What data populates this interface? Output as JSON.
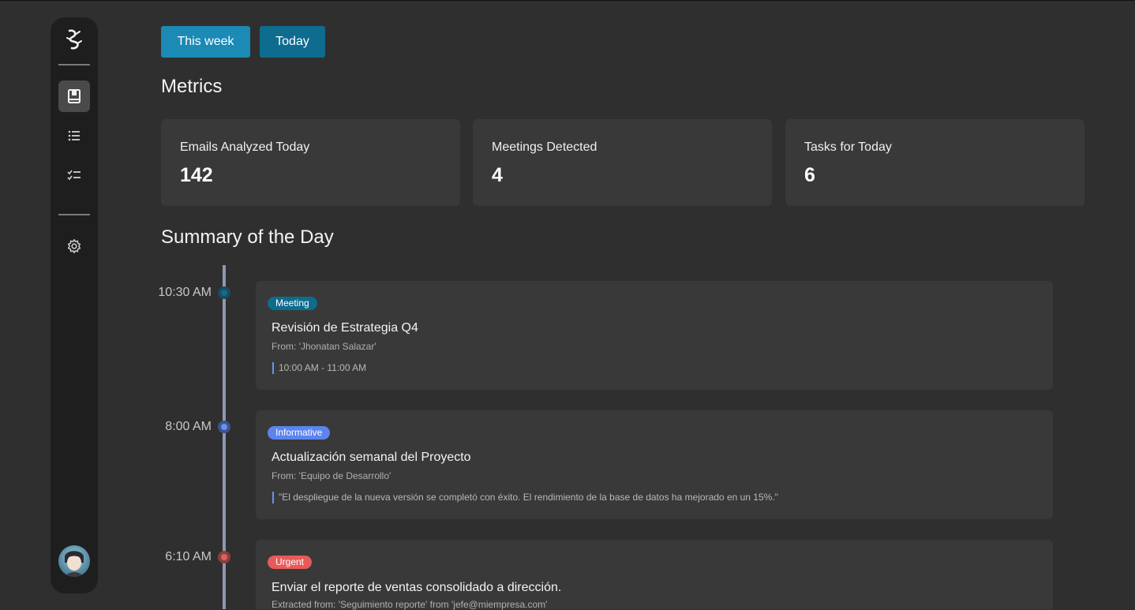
{
  "filters": {
    "week_label": "This week",
    "today_label": "Today"
  },
  "sections": {
    "metrics": "Metrics",
    "summary": "Summary of the Day"
  },
  "metrics": [
    {
      "label": "Emails Analyzed Today",
      "value": "142"
    },
    {
      "label": "Meetings Detected",
      "value": "4"
    },
    {
      "label": "Tasks for Today",
      "value": "6"
    }
  ],
  "sidebar": {
    "items": [
      {
        "icon": "book-icon",
        "active": true
      },
      {
        "icon": "list-icon",
        "active": false
      },
      {
        "icon": "checklist-icon",
        "active": false
      },
      {
        "icon": "gear-icon",
        "active": false
      }
    ]
  },
  "timeline": [
    {
      "time": "10:30 AM",
      "badge": "Meeting",
      "title": "Revisión de Estrategia Q4",
      "from": "From: 'Jhonatan Salazar'",
      "detail": "10:00 AM - 11:00 AM"
    },
    {
      "time": "8:00 AM",
      "badge": "Informative",
      "title": "Actualización semanal del Proyecto",
      "from": "From: 'Equipo de Desarrollo'",
      "detail": "\"El despliegue de la nueva versión se completó con éxito. El rendimiento de la base de datos ha mejorado en un 15%.\""
    },
    {
      "time": "6:10 AM",
      "badge": "Urgent",
      "title": "Enviar el reporte de ventas consolidado a dirección.",
      "from": "Extracted from: 'Seguimiento reporte' from 'jefe@miempresa.com'"
    }
  ],
  "colors": {
    "accent": "#1b8ab5",
    "meeting": "#0e6c8f",
    "informative": "#5b84ef",
    "urgent": "#e85a5a"
  }
}
